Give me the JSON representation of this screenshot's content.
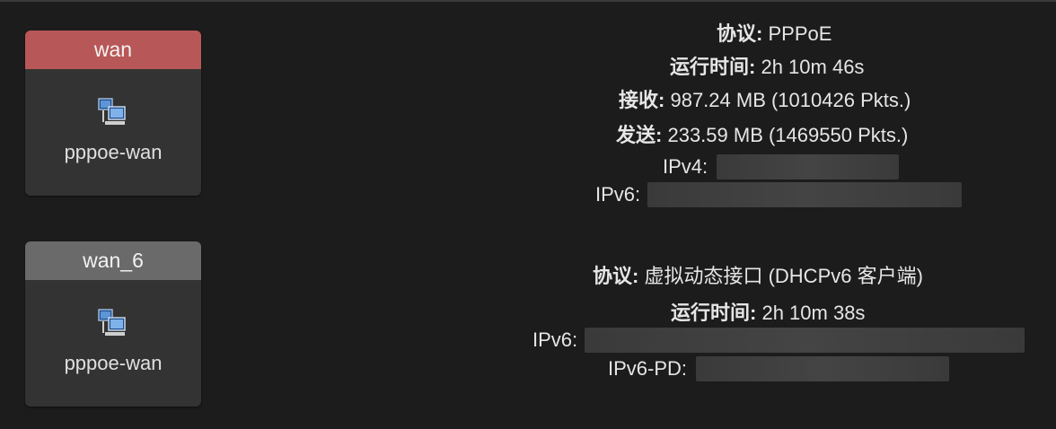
{
  "wan": {
    "name": "wan",
    "device": "pppoe-wan",
    "protocol_label": "协议",
    "protocol": "PPPoE",
    "uptime_label": "运行时间",
    "uptime": "2h 10m 46s",
    "rx_label": "接收",
    "rx": "987.24 MB (1010426 Pkts.)",
    "tx_label": "发送",
    "tx": "233.59 MB (1469550 Pkts.)",
    "ipv4_label": "IPv4:",
    "ipv6_label": "IPv6:"
  },
  "wan6": {
    "name": "wan_6",
    "device": "pppoe-wan",
    "protocol_label": "协议",
    "protocol": "虚拟动态接口 (DHCPv6 客户端)",
    "uptime_label": "运行时间",
    "uptime": "2h 10m 38s",
    "ipv6_label": "IPv6:",
    "ipv6pd_label": "IPv6-PD:"
  },
  "colors": {
    "wan_header": "#b85757",
    "wan6_header": "#6a6a6a",
    "background": "#1c1c1c",
    "card": "#333333"
  },
  "icons": {
    "device": "network-device-icon"
  }
}
